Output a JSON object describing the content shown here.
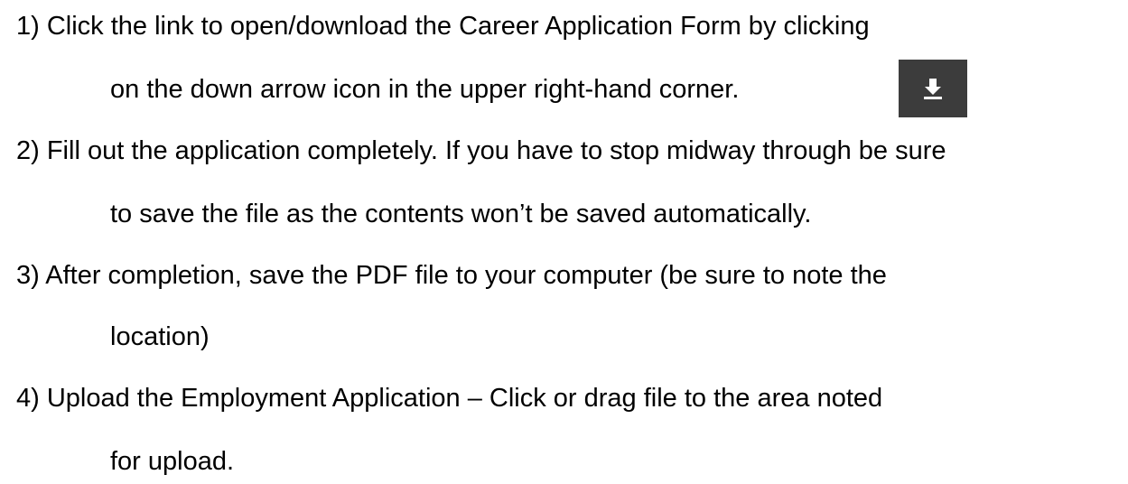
{
  "instructions": [
    {
      "line1": "1) Click the link to open/download the Career Application Form by clicking",
      "line2": "on the down arrow icon in the upper right-hand corner."
    },
    {
      "line1": "2) Fill out the application completely. If you have to stop midway through be sure",
      "line2": "to save the file as the contents won’t be saved automatically."
    },
    {
      "line1": "3) After completion, save the PDF file to your computer (be sure to note the",
      "line2": "location)"
    },
    {
      "line1": "4) Upload the Employment Application – Click or drag file to the area noted",
      "line2": "for upload."
    }
  ],
  "download_icon": {
    "icon": "download-arrow-icon",
    "background_color": "#3c3c3c",
    "icon_color": "#ffffff"
  }
}
